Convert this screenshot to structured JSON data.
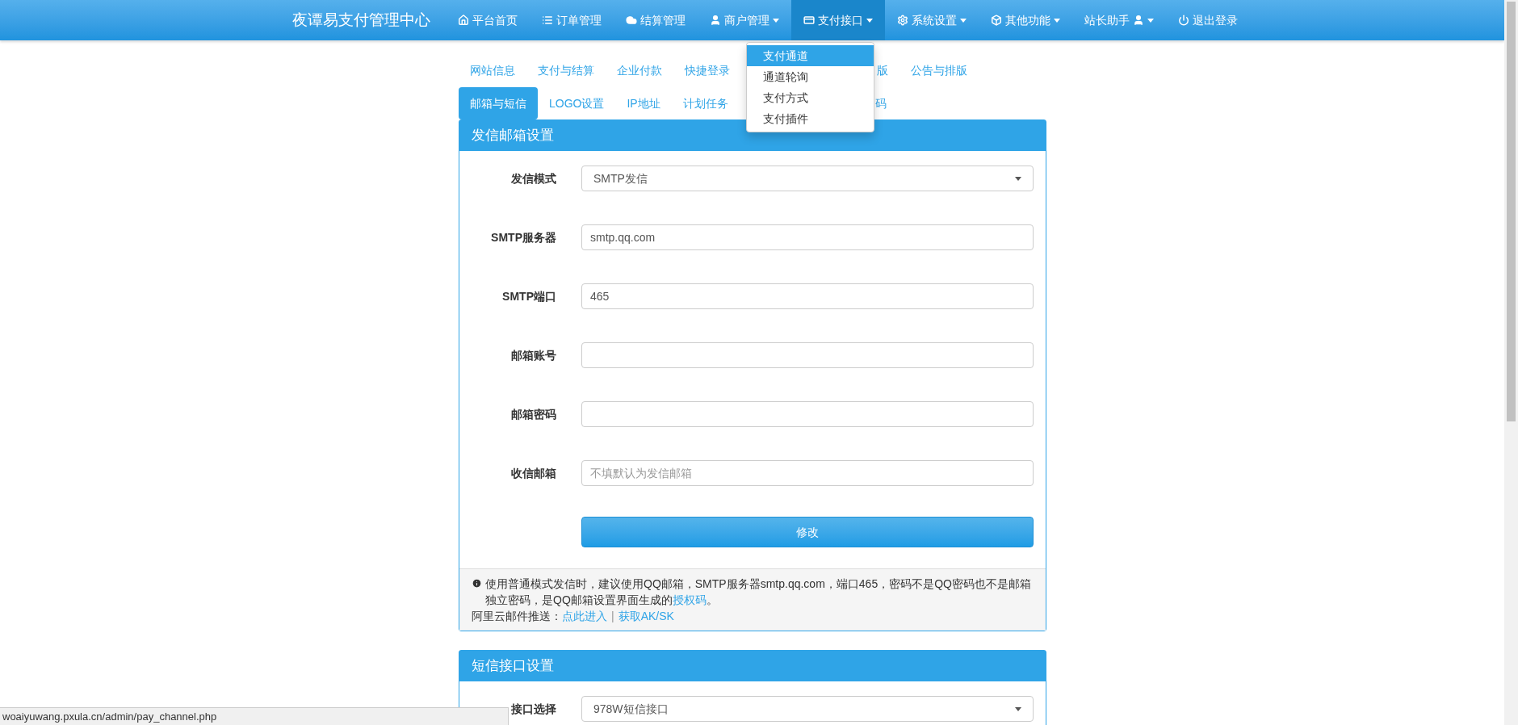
{
  "navbar": {
    "brand": "夜谭易支付管理中心",
    "items": [
      {
        "label": "平台首页",
        "dropdown": false,
        "selected": false
      },
      {
        "label": "订单管理",
        "dropdown": false,
        "selected": false
      },
      {
        "label": "结算管理",
        "dropdown": false,
        "selected": false
      },
      {
        "label": "商户管理",
        "dropdown": true,
        "selected": false
      },
      {
        "label": "支付接口",
        "dropdown": true,
        "selected": true
      },
      {
        "label": "系统设置",
        "dropdown": true,
        "selected": false
      },
      {
        "label": "其他功能",
        "dropdown": true,
        "selected": false
      },
      {
        "label": "站长助手",
        "dropdown": true,
        "selected": false
      },
      {
        "label": "退出登录",
        "dropdown": false,
        "selected": false
      }
    ]
  },
  "dropdown_menu": {
    "items": [
      {
        "label": "支付通道",
        "selected": true
      },
      {
        "label": "通道轮询",
        "selected": false
      },
      {
        "label": "支付方式",
        "selected": false
      },
      {
        "label": "支付插件",
        "selected": false
      }
    ]
  },
  "tabs": [
    [
      {
        "label": "网站信息",
        "selected": false,
        "kind": "full"
      },
      {
        "label": "支付与结算",
        "selected": false,
        "kind": "full"
      },
      {
        "label": "企业付款",
        "selected": false,
        "kind": "full"
      },
      {
        "label": "快捷登录",
        "selected": false,
        "kind": "full"
      },
      {
        "label": "版",
        "selected": false,
        "kind": "partial"
      },
      {
        "label": "公告与排版",
        "selected": false,
        "kind": "full"
      }
    ],
    [
      {
        "label": "邮箱与短信",
        "selected": true,
        "kind": "full"
      },
      {
        "label": "LOGO设置",
        "selected": false,
        "kind": "full"
      },
      {
        "label": "IP地址",
        "selected": false,
        "kind": "full"
      },
      {
        "label": "计划任务",
        "selected": false,
        "kind": "full"
      },
      {
        "label": "码",
        "selected": false,
        "kind": "partial"
      }
    ]
  ],
  "panels": [
    {
      "title": "发信邮箱设置",
      "fields": [
        {
          "label": "发信模式",
          "kind": "select",
          "value": "SMTP发信"
        },
        {
          "label": "SMTP服务器",
          "kind": "input",
          "value": "smtp.qq.com"
        },
        {
          "label": "SMTP端口",
          "kind": "input",
          "value": "465"
        },
        {
          "label": "邮箱账号",
          "kind": "input"
        },
        {
          "label": "邮箱密码",
          "kind": "input"
        },
        {
          "label": "收信邮箱",
          "kind": "input",
          "placeholder": "不填默认为发信邮箱"
        }
      ],
      "submit": "修改",
      "note": {
        "text": "使用普通模式发信时，建议使用QQ邮箱，SMTP服务器smtp.qq.com，端口465，密码不是QQ密码也不是邮箱独立密码，是QQ邮箱设置界面生成的",
        "link": "授权码",
        "end": "。",
        "line2_label": "阿里云邮件推送：",
        "line2_link1": "点此进入",
        "separator": "|",
        "line2_link2": "获取AK/SK"
      }
    },
    {
      "title": "短信接口设置",
      "fields": [
        {
          "label": "接口选择",
          "kind": "select",
          "value": "978W短信接口"
        }
      ]
    }
  ],
  "status_bar": {
    "url": "woaiyuwang.pxula.cn/admin/pay_channel.php"
  }
}
